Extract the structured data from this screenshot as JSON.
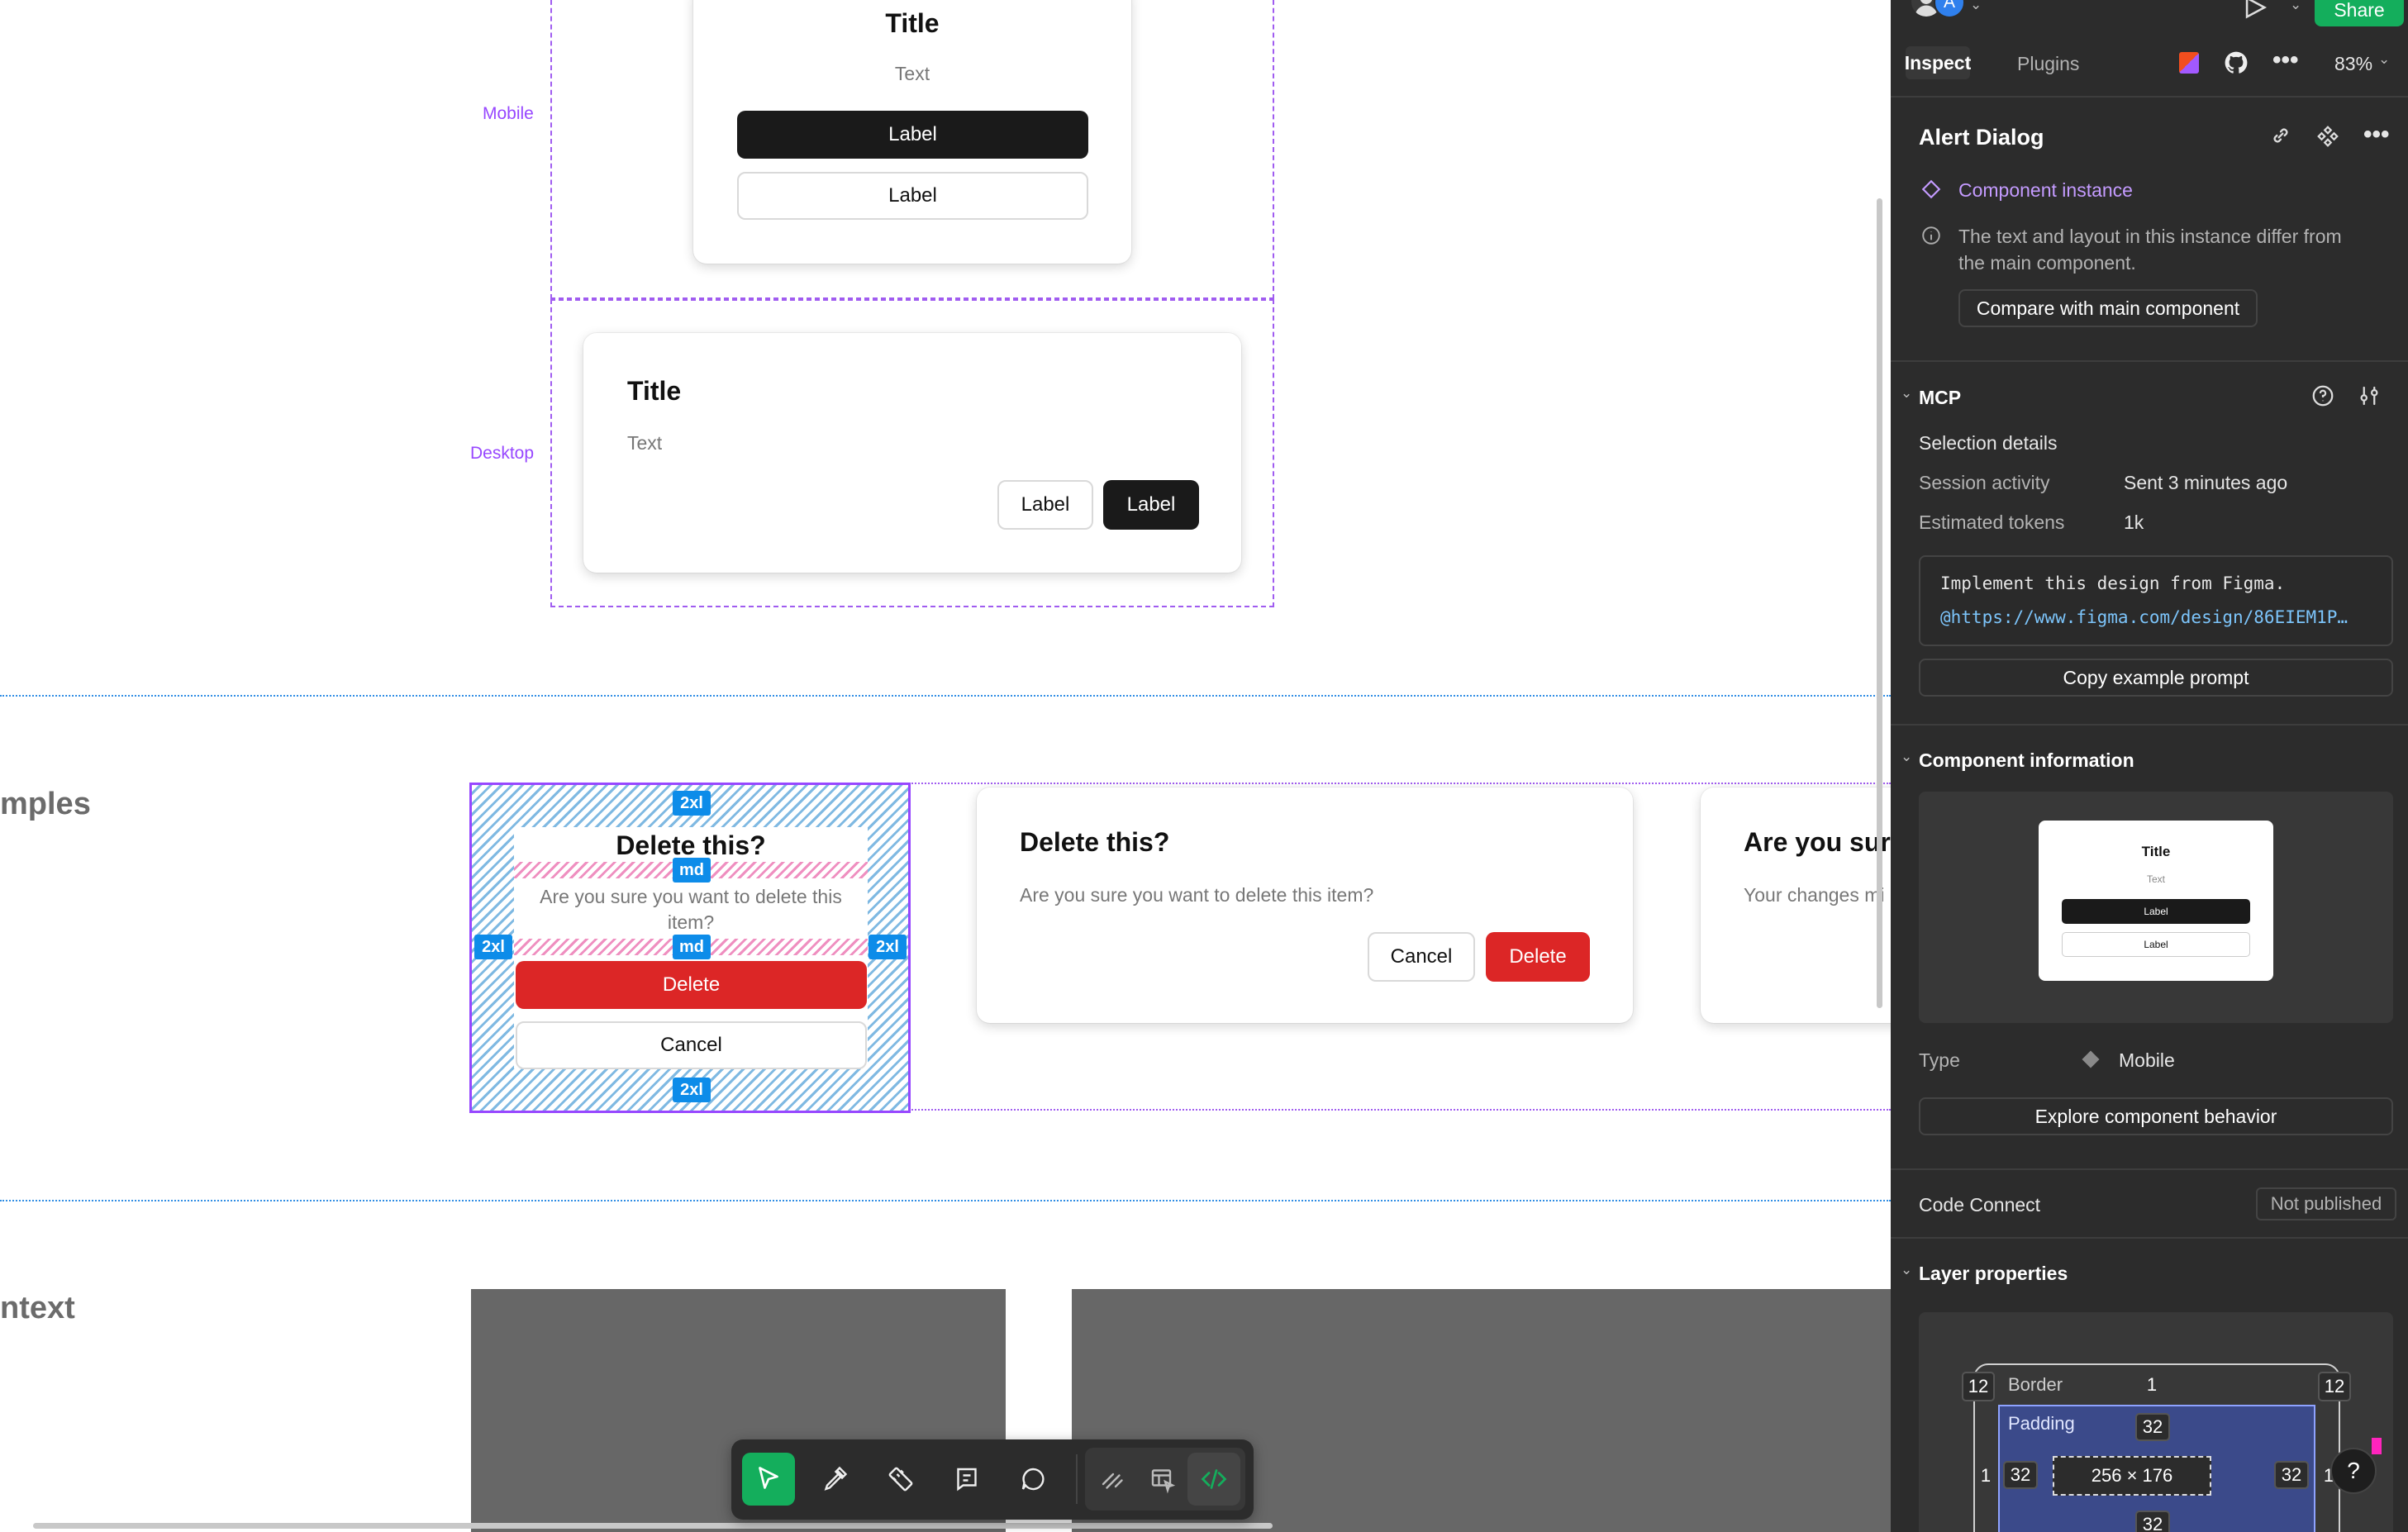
{
  "canvas": {
    "frames": {
      "mobile_label": "Mobile",
      "desktop_label": "Desktop"
    },
    "mobile_card": {
      "title": "Title",
      "text": "Text",
      "primary_label": "Label",
      "secondary_label": "Label"
    },
    "desktop_card": {
      "title": "Title",
      "text": "Text",
      "secondary_label": "Label",
      "primary_label": "Label"
    },
    "examples_section": {
      "heading": "mples",
      "selected_dialog": {
        "title": "Delete this?",
        "body": "Are you sure you want to delete this item?",
        "delete_label": "Delete",
        "cancel_label": "Cancel",
        "spacing_tags": {
          "top": "2xl",
          "after_title": "md",
          "after_body": "md",
          "left": "2xl",
          "right": "2xl",
          "bottom": "2xl"
        }
      },
      "desktop_dialog": {
        "title": "Delete this?",
        "body": "Are you sure you want to delete this item?",
        "cancel_label": "Cancel",
        "delete_label": "Delete"
      },
      "partial_dialog": {
        "title": "Are you sur",
        "body": "Your changes mi"
      }
    },
    "context_section": {
      "heading": "ntext"
    }
  },
  "toolbar": {
    "tools": [
      "move-tool",
      "pen-tool",
      "measure-tool",
      "annotate-tool",
      "comment-tool",
      "draw-tool",
      "dev-resources-tool",
      "code-tool"
    ],
    "active_tool": "move-tool",
    "accent": "#14ae5c"
  },
  "panel": {
    "header": {
      "avatar_initial": "A",
      "share_label": "Share",
      "tab_inspect": "Inspect",
      "tab_plugins": "Plugins",
      "zoom": "83%"
    },
    "selection": {
      "name": "Alert Dialog",
      "component_instance_label": "Component instance",
      "info_text_line1": "The text and layout in this instance differ from",
      "info_text_line2": "the main component.",
      "compare_label": "Compare with main component"
    },
    "mcp": {
      "heading": "MCP",
      "selection_details": "Selection details",
      "session_activity_label": "Session activity",
      "session_activity_value": "Sent 3 minutes ago",
      "estimated_tokens_label": "Estimated tokens",
      "estimated_tokens_value": "1k",
      "prompt_line1": "Implement this design from Figma.",
      "prompt_line2": "@https://www.figma.com/design/86EIEM1P…",
      "copy_prompt_label": "Copy example prompt"
    },
    "component_info": {
      "heading": "Component information",
      "preview": {
        "title": "Title",
        "text": "Text",
        "primary_label": "Label",
        "secondary_label": "Label"
      },
      "type_label": "Type",
      "type_value": "Mobile",
      "explore_label": "Explore component behavior"
    },
    "code_connect": {
      "label": "Code Connect",
      "status": "Not published"
    },
    "layer_properties": {
      "heading": "Layer properties",
      "radius_tl": "12",
      "radius_tr": "12",
      "border_label": "Border",
      "border_value": "1",
      "border_left": "1",
      "border_right": "1",
      "padding_label": "Padding",
      "padding_top": "32",
      "padding_left": "32",
      "padding_right": "32",
      "padding_bottom": "32",
      "size": "256 × 176"
    },
    "help_label": "?"
  },
  "colors": {
    "panel_bg": "#2c2c2c",
    "accent_green": "#14ae5c",
    "component_purple": "#c49bff",
    "link_blue": "#7cc4fa",
    "danger_red": "#dc2626",
    "spacing_blue": "#0d8ce9"
  }
}
